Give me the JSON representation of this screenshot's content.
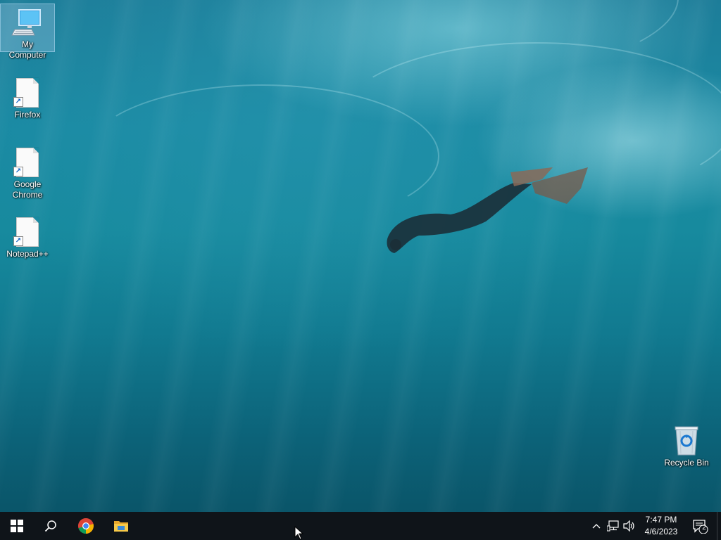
{
  "desktop": {
    "icons": [
      {
        "label": "My Computer",
        "icon": "computer-icon"
      },
      {
        "label": "Firefox",
        "icon": "shortcut-file-icon"
      },
      {
        "label": "Google Chrome",
        "icon": "shortcut-file-icon"
      },
      {
        "label": "Notepad++",
        "icon": "shortcut-file-icon"
      },
      {
        "label": "Recycle Bin",
        "icon": "recycle-bin-icon"
      }
    ]
  },
  "taskbar": {
    "pinned": [
      {
        "icon": "windows-start-icon"
      },
      {
        "icon": "search-icon"
      },
      {
        "icon": "chrome-icon"
      },
      {
        "icon": "file-explorer-icon"
      }
    ],
    "tray": {
      "icons": [
        "chevron-up-icon",
        "network-icon",
        "volume-icon"
      ],
      "time": "7:47 PM",
      "date": "4/6/2023",
      "notification_count": "2"
    }
  },
  "colors": {
    "taskbar_bg": "#0f1419",
    "selection": "#a0c8e6",
    "wallpaper_primary": "#178a9e"
  }
}
